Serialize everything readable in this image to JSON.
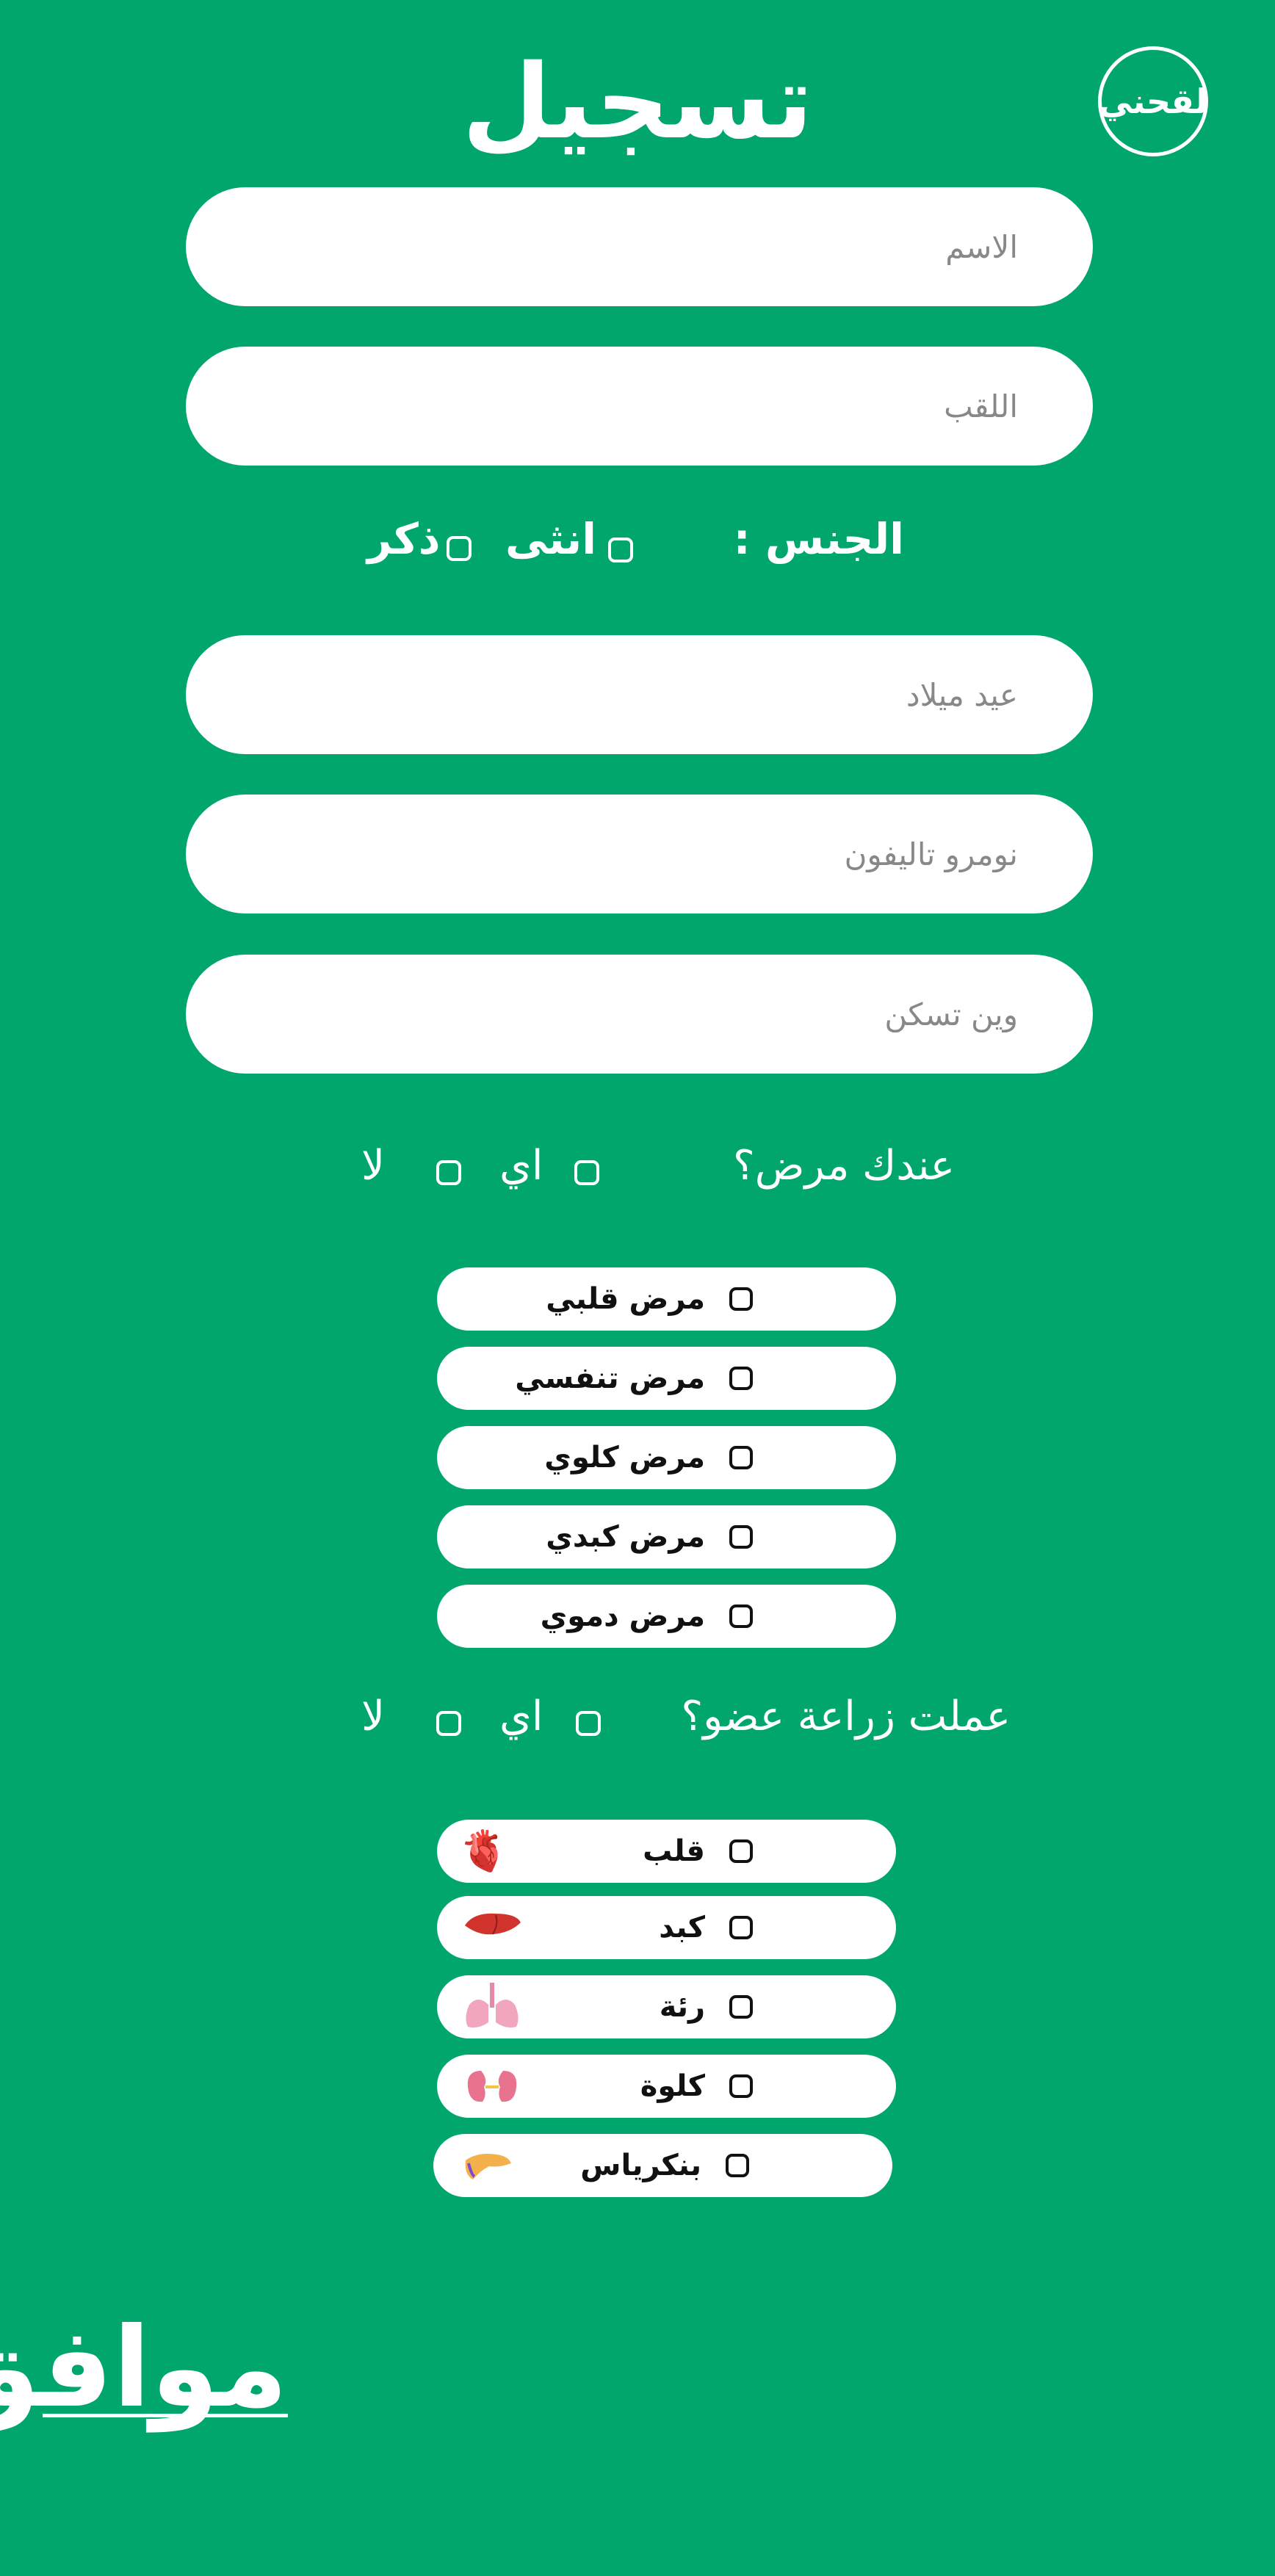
{
  "header": {
    "title": "تسجيل",
    "logo_text": "لقحني"
  },
  "form": {
    "first_name": {
      "placeholder": "الاسم"
    },
    "last_name": {
      "placeholder": "اللقب"
    },
    "gender": {
      "label": "الجنس :",
      "female": "انثى",
      "male": "ذكر"
    },
    "birthday": {
      "placeholder": "عيد ميلاد"
    },
    "phone": {
      "placeholder": "نومرو تاليفون"
    },
    "address": {
      "placeholder": "وين تسكن"
    }
  },
  "disease": {
    "question": "عندك مرض؟",
    "yes": "اي",
    "no": "لا",
    "options": [
      "مرض قلبي",
      "مرض تنفسي",
      "مرض كلوي",
      "مرض كبدي",
      "مرض دموي"
    ]
  },
  "transplant": {
    "question": "عملت زراعة عضو؟",
    "yes": "اي",
    "no": "لا",
    "options": [
      {
        "label": "قلب",
        "icon": "heart-organ-icon",
        "emoji": "🫀"
      },
      {
        "label": "كبد",
        "icon": "liver-icon",
        "emoji": "🫁"
      },
      {
        "label": "رئة",
        "icon": "lungs-icon",
        "emoji": "🫁"
      },
      {
        "label": "كلوة",
        "icon": "kidney-icon",
        "emoji": "🫘"
      },
      {
        "label": "بنكرياس",
        "icon": "pancreas-icon",
        "emoji": "🫃"
      }
    ]
  },
  "submit_label": "موافق",
  "colors": {
    "background": "#00a66b",
    "field": "#ffffff",
    "text": "#ffffff"
  }
}
